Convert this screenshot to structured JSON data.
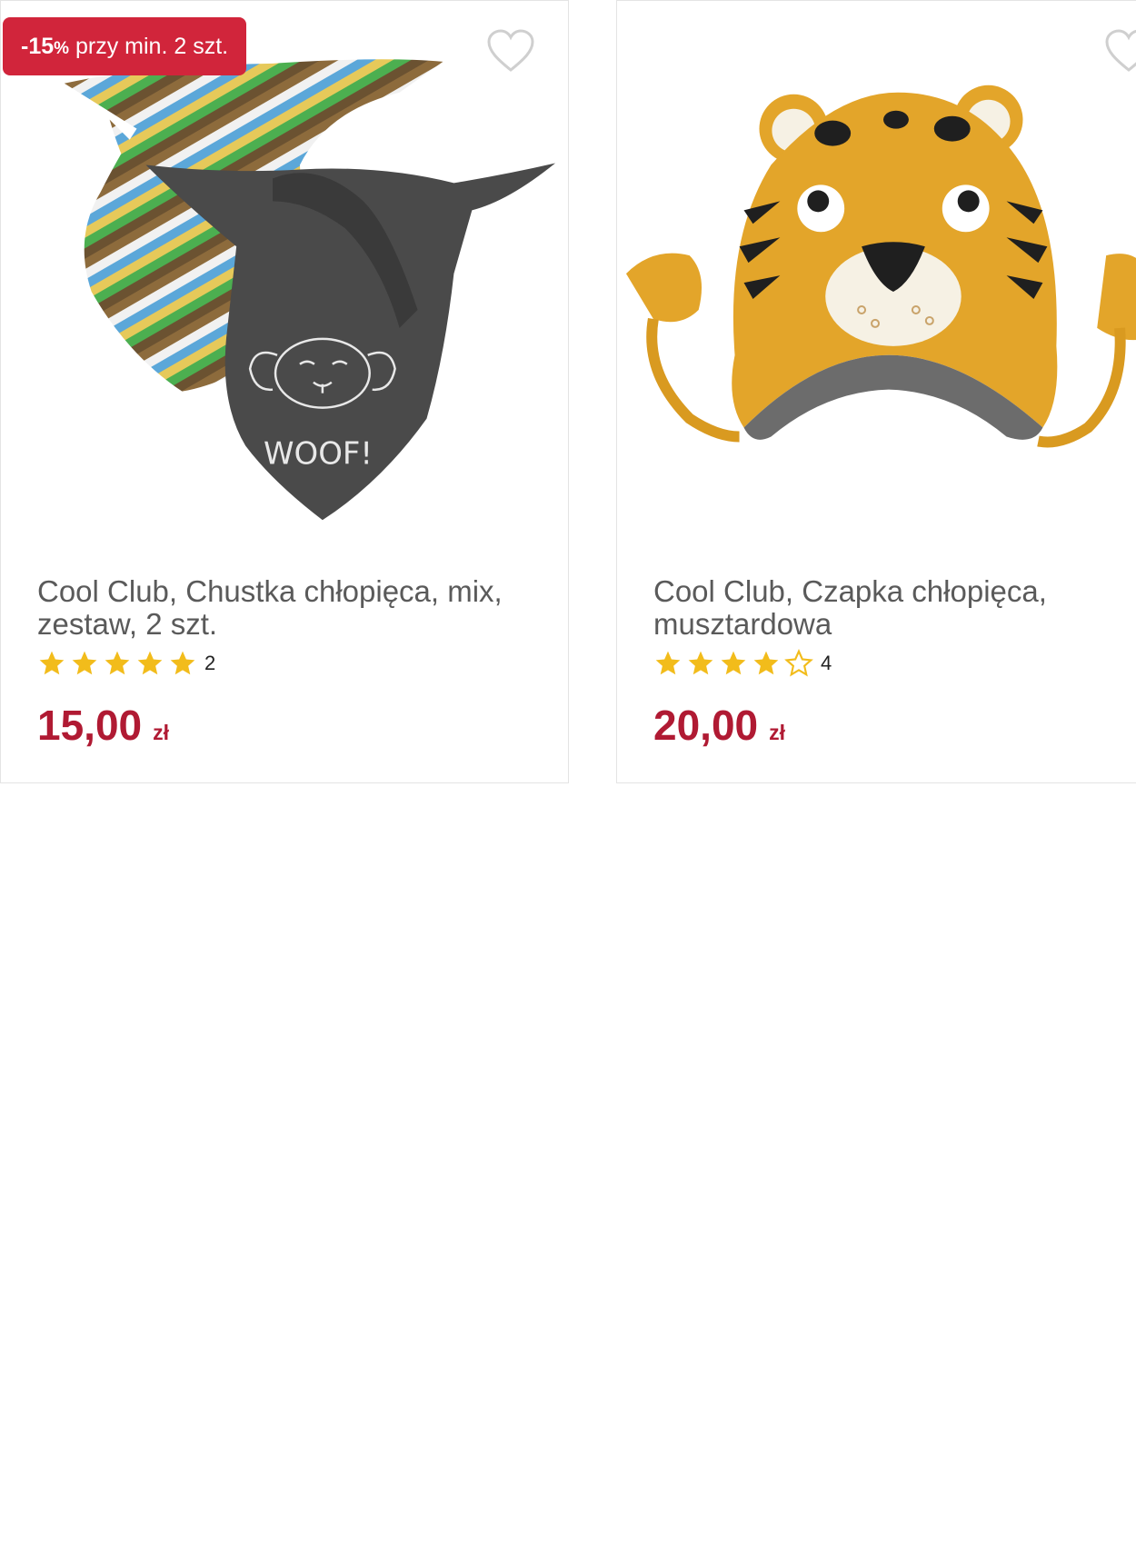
{
  "colors": {
    "accent": "#b01a33",
    "promo_bg": "#d1253b",
    "star": "#f2bc1b"
  },
  "products": [
    {
      "promo": {
        "discount": "-15",
        "percent": "%",
        "condition": "przy min. 2 szt."
      },
      "title": "Cool Club, Chustka chłopięca, mix, zestaw, 2 szt.",
      "rating": {
        "stars_filled": 5,
        "stars_total": 5,
        "count": "2"
      },
      "price": {
        "amount": "15,00",
        "currency": "zł"
      },
      "image_text": "WOOF!",
      "icons": {
        "favorite": "heart-outline-icon",
        "star": "star-icon"
      }
    },
    {
      "title": "Cool Club, Czapka chłopięca, musztardowa",
      "rating": {
        "stars_filled": 4,
        "stars_total": 5,
        "count": "4"
      },
      "price": {
        "amount": "20,00",
        "currency": "zł"
      },
      "icons": {
        "favorite": "heart-outline-icon",
        "star": "star-icon"
      }
    }
  ]
}
